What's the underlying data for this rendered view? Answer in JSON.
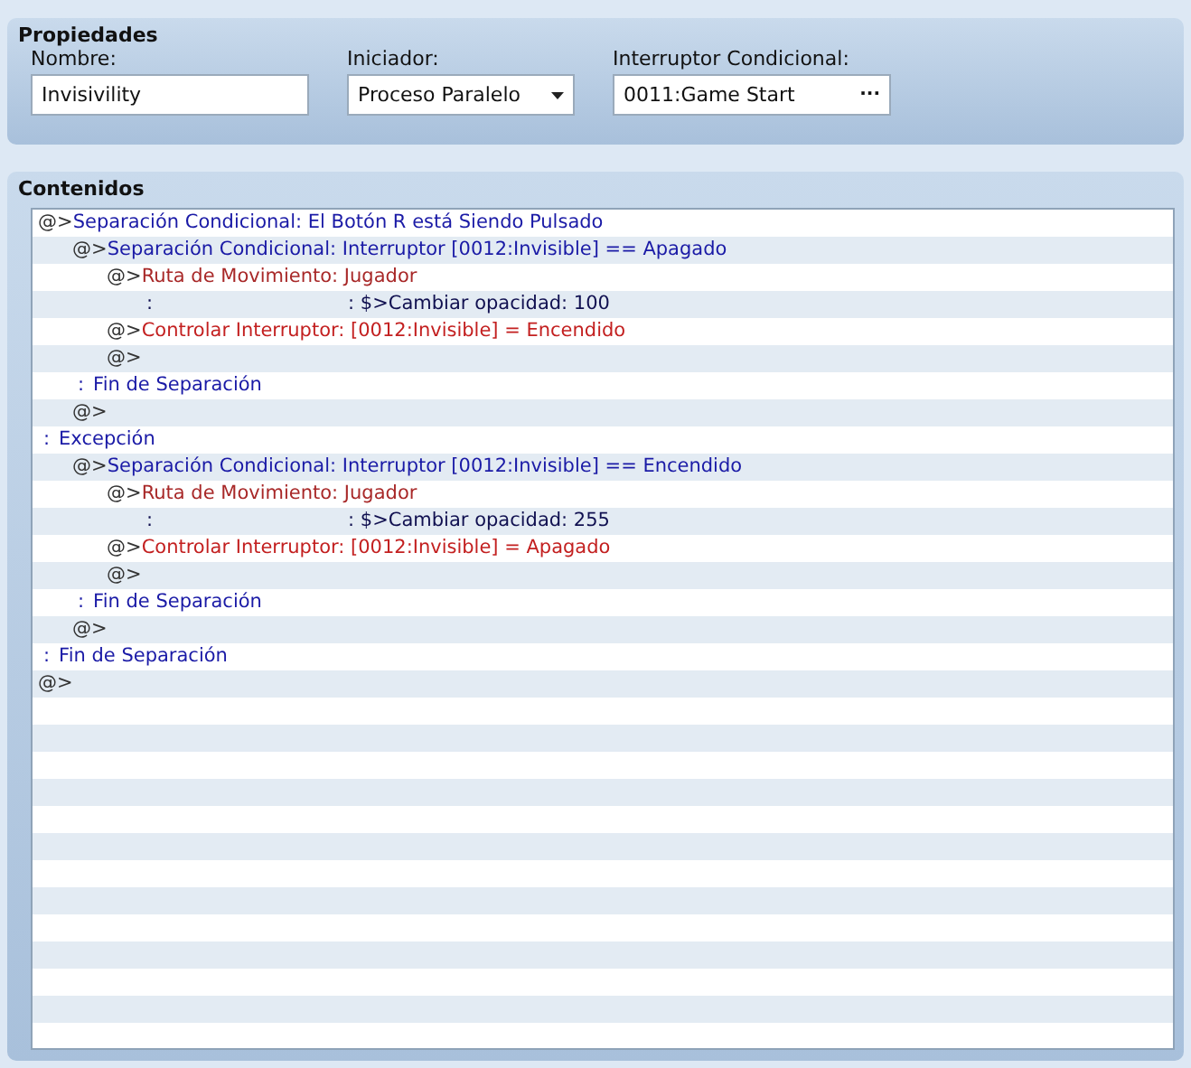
{
  "properties": {
    "title": "Propiedades",
    "name_field": {
      "label": "Nombre:",
      "value": "Invisivility"
    },
    "trigger_field": {
      "label": "Iniciador:",
      "value": "Proceso Paralelo"
    },
    "switch_field": {
      "label": "Interruptor Condicional:",
      "value": "0011:Game Start",
      "button": "···"
    }
  },
  "contents": {
    "title": "Contenidos",
    "commands": [
      {
        "kind": "branch",
        "prefix": "@>",
        "text": "Separación Condicional: El Botón R está Siendo Pulsado",
        "children": [
          {
            "kind": "branch",
            "prefix": "@>",
            "text": "Separación Condicional: Interruptor [0012:Invisible] == Apagado",
            "children": [
              {
                "kind": "route",
                "prefix": "@>",
                "text": "Ruta de Movimiento: Jugador",
                "children": [
                  {
                    "kind": "step",
                    "prefix": ":",
                    "text": ": $>Cambiar opacidad: 100"
                  }
                ]
              },
              {
                "kind": "action",
                "prefix": "@>",
                "text": "Controlar Interruptor: [0012:Invisible] = Encendido"
              },
              {
                "kind": "empty",
                "prefix": "@>"
              }
            ]
          },
          {
            "kind": "end",
            "prefix": ":",
            "text": "Fin de Separación"
          },
          {
            "kind": "empty",
            "prefix": "@>"
          }
        ]
      },
      {
        "kind": "else",
        "prefix": ":",
        "text": "Excepción",
        "children": [
          {
            "kind": "branch",
            "prefix": "@>",
            "text": "Separación Condicional: Interruptor [0012:Invisible] == Encendido",
            "children": [
              {
                "kind": "route",
                "prefix": "@>",
                "text": "Ruta de Movimiento: Jugador",
                "children": [
                  {
                    "kind": "step",
                    "prefix": ":",
                    "text": ": $>Cambiar opacidad: 255"
                  }
                ]
              },
              {
                "kind": "action",
                "prefix": "@>",
                "text": "Controlar Interruptor: [0012:Invisible] = Apagado"
              },
              {
                "kind": "empty",
                "prefix": "@>"
              }
            ]
          },
          {
            "kind": "end",
            "prefix": ":",
            "text": "Fin de Separación"
          },
          {
            "kind": "empty",
            "prefix": "@>"
          }
        ]
      },
      {
        "kind": "end",
        "prefix": ":",
        "text": "Fin de Separación"
      },
      {
        "kind": "empty",
        "prefix": "@>"
      }
    ]
  }
}
